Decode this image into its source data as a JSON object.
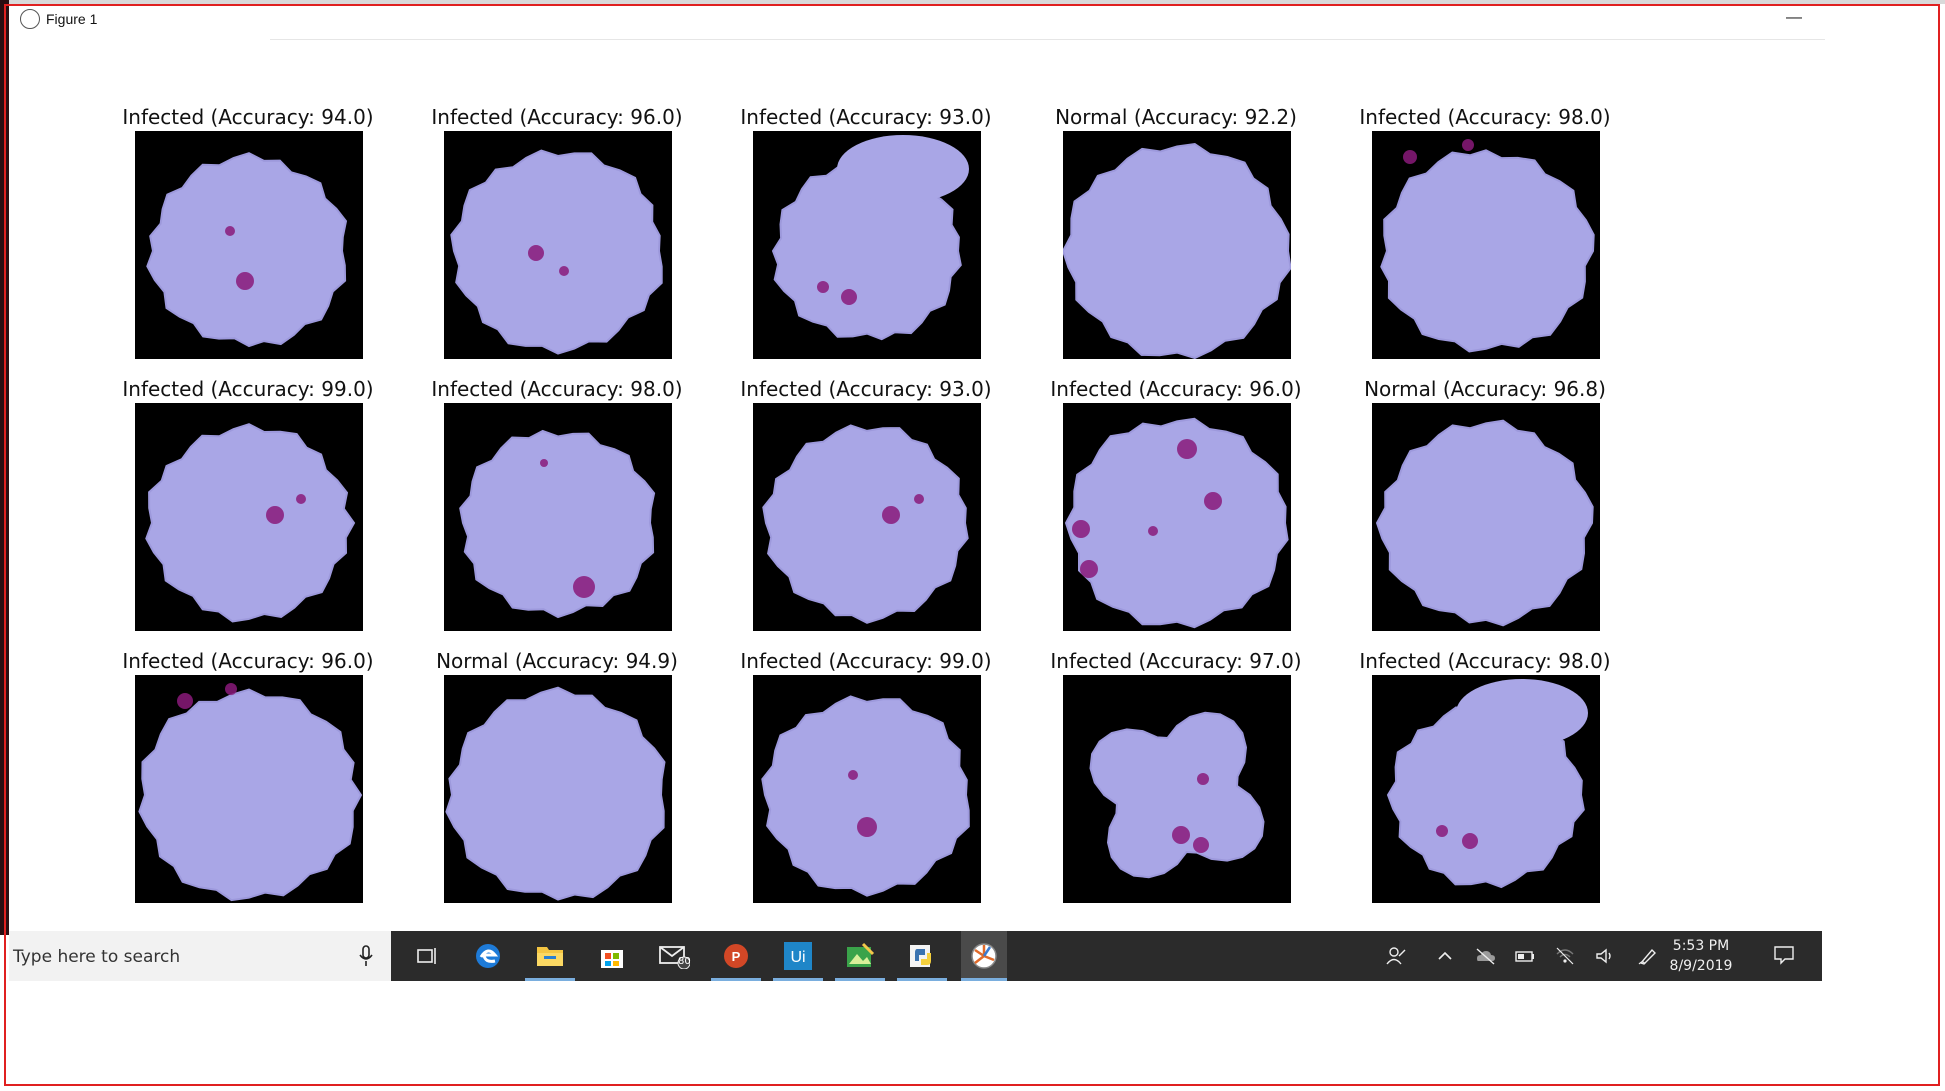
{
  "window": {
    "title": "Figure 1",
    "minimize_glyph": "—"
  },
  "figure": {
    "cells": [
      {
        "label": "Infected (Accuracy: 94.0)",
        "class": "Infected",
        "accuracy": 94.0
      },
      {
        "label": "Infected (Accuracy: 96.0)",
        "class": "Infected",
        "accuracy": 96.0
      },
      {
        "label": "Infected (Accuracy: 93.0)",
        "class": "Infected",
        "accuracy": 93.0
      },
      {
        "label": "Normal (Accuracy: 92.2)",
        "class": "Normal",
        "accuracy": 92.2
      },
      {
        "label": "Infected (Accuracy: 98.0)",
        "class": "Infected",
        "accuracy": 98.0
      },
      {
        "label": "Infected (Accuracy: 99.0)",
        "class": "Infected",
        "accuracy": 99.0
      },
      {
        "label": "Infected (Accuracy: 98.0)",
        "class": "Infected",
        "accuracy": 98.0
      },
      {
        "label": "Infected (Accuracy: 93.0)",
        "class": "Infected",
        "accuracy": 93.0
      },
      {
        "label": "Infected (Accuracy: 96.0)",
        "class": "Infected",
        "accuracy": 96.0
      },
      {
        "label": "Normal (Accuracy: 96.8)",
        "class": "Normal",
        "accuracy": 96.8
      },
      {
        "label": "Infected (Accuracy: 96.0)",
        "class": "Infected",
        "accuracy": 96.0
      },
      {
        "label": "Normal (Accuracy: 94.9)",
        "class": "Normal",
        "accuracy": 94.9
      },
      {
        "label": "Infected (Accuracy: 99.0)",
        "class": "Infected",
        "accuracy": 99.0
      },
      {
        "label": "Infected (Accuracy: 97.0)",
        "class": "Infected",
        "accuracy": 97.0
      },
      {
        "label": "Infected (Accuracy: 98.0)",
        "class": "Infected",
        "accuracy": 98.0
      }
    ],
    "colors": {
      "cell_fill": "#a9a6e6",
      "cell_edge": "#9d99dc",
      "stain": "#8a1a7a",
      "background": "#000000"
    }
  },
  "taskbar": {
    "search_placeholder": "Type here to search",
    "mail_badge": "80",
    "apps": [
      "task-view-icon",
      "edge-icon",
      "file-explorer-icon",
      "store-icon",
      "mail-icon",
      "powerpoint-icon",
      "uipath-icon",
      "photo-editor-icon",
      "python-icon",
      "figure-app-icon"
    ],
    "time": "5:53 PM",
    "date": "8/9/2019"
  },
  "colors": {
    "frame_red": "#e02020",
    "taskbar_bg": "#2b2b2b",
    "accent": "#7aaede"
  }
}
